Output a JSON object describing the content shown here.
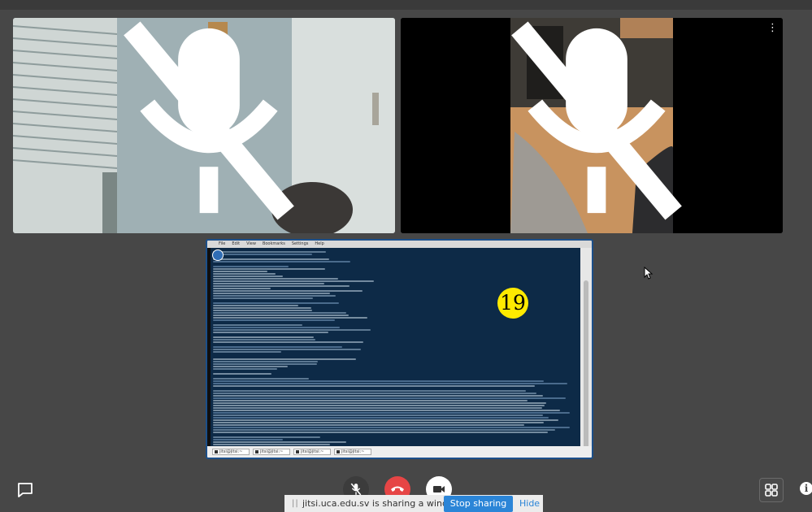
{
  "participant_tiles": [
    {
      "id": "room-camera",
      "mic_muted": true
    },
    {
      "id": "desk-camera",
      "mic_muted": true
    }
  ],
  "shared_window": {
    "terminal_menu": [
      "File",
      "Edit",
      "View",
      "Bookmarks",
      "Settings",
      "Help"
    ],
    "taskbar_items": [
      "jitsi@jitsi:~",
      "jitsi@jitsi:~",
      "jitsi@jitsi:~",
      "jitsi@jitsi:~"
    ],
    "marker_number": "19"
  },
  "toolbar": {
    "chat_icon": "chat-icon",
    "mic_icon": "mic-off-icon",
    "hangup_icon": "hangup-icon",
    "camera_icon": "camera-icon",
    "tile_view_icon": "grid-icon",
    "info_label": "i"
  },
  "share_banner": {
    "message": "jitsi.uca.edu.sv is sharing a window.",
    "stop_label": "Stop sharing",
    "hide_label": "Hide"
  },
  "colors": {
    "background": "#474747",
    "hangup": "#e64545",
    "accent": "#2b85d7",
    "marker": "#ffea00"
  }
}
